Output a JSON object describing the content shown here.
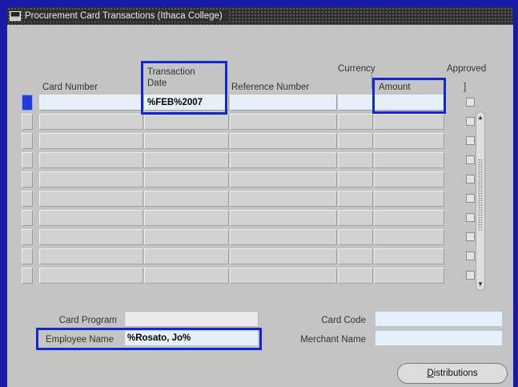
{
  "window": {
    "title": "Procurement Card Transactions (Ithaca College)",
    "icon_text": "███"
  },
  "table": {
    "headers": {
      "card_number": "Card Number",
      "transaction_date_line1": "Transaction",
      "transaction_date_line2": "Date",
      "reference_number": "Reference Number",
      "currency": "Currency",
      "amount": "Amount",
      "approved": "Approved",
      "approved_bracket": "]"
    },
    "rows": [
      {
        "card_number": "",
        "transaction_date": "%FEB%2007",
        "reference_number": "",
        "currency": "",
        "amount": "",
        "approved": false
      },
      {
        "card_number": "",
        "transaction_date": "",
        "reference_number": "",
        "currency": "",
        "amount": "",
        "approved": false
      },
      {
        "card_number": "",
        "transaction_date": "",
        "reference_number": "",
        "currency": "",
        "amount": "",
        "approved": false
      },
      {
        "card_number": "",
        "transaction_date": "",
        "reference_number": "",
        "currency": "",
        "amount": "",
        "approved": false
      },
      {
        "card_number": "",
        "transaction_date": "",
        "reference_number": "",
        "currency": "",
        "amount": "",
        "approved": false
      },
      {
        "card_number": "",
        "transaction_date": "",
        "reference_number": "",
        "currency": "",
        "amount": "",
        "approved": false
      },
      {
        "card_number": "",
        "transaction_date": "",
        "reference_number": "",
        "currency": "",
        "amount": "",
        "approved": false
      },
      {
        "card_number": "",
        "transaction_date": "",
        "reference_number": "",
        "currency": "",
        "amount": "",
        "approved": false
      },
      {
        "card_number": "",
        "transaction_date": "",
        "reference_number": "",
        "currency": "",
        "amount": "",
        "approved": false
      },
      {
        "card_number": "",
        "transaction_date": "",
        "reference_number": "",
        "currency": "",
        "amount": "",
        "approved": false
      }
    ]
  },
  "footer": {
    "card_program_label": "Card Program",
    "card_program_value": "",
    "employee_name_label": "Employee Name",
    "employee_name_value": "%Rosato, Jo%",
    "card_code_label": "Card Code",
    "card_code_value": "",
    "merchant_name_label": "Merchant Name",
    "merchant_name_value": ""
  },
  "buttons": {
    "distributions": "Distributions"
  },
  "colors": {
    "highlight": "#1027d8",
    "form_background": "#c4c4c4",
    "active_field": "#e6f0fb"
  }
}
